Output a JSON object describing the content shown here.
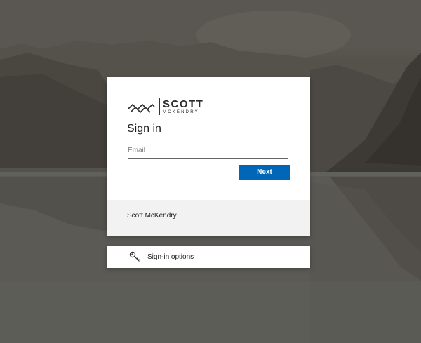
{
  "background": {
    "description_icon": "mountain-lake-wallpaper"
  },
  "card": {
    "logo": {
      "word1": "SCOTT",
      "word2": "MCKENDRY"
    },
    "title": "Sign in",
    "email": {
      "placeholder": "Email",
      "value": ""
    },
    "next_label": "Next",
    "footer_text": "Scott McKendry"
  },
  "options": {
    "icon": "key-icon",
    "label": "Sign-in options"
  },
  "colors": {
    "accent": "#0067b8",
    "card_bg": "#ffffff",
    "footer_bg": "#f2f2f2"
  }
}
